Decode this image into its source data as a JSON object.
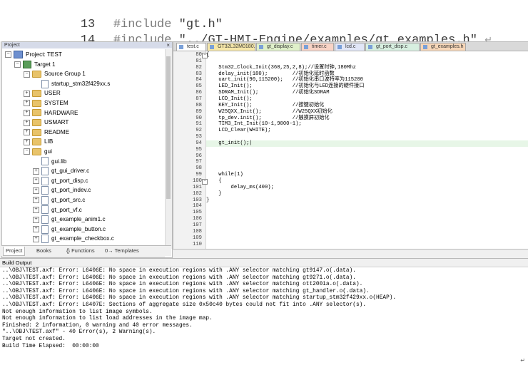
{
  "doc_snippet": {
    "lines": [
      {
        "num": "13",
        "directive": "#include",
        "path": "\"gt.h\""
      },
      {
        "num": "14",
        "directive": "#include",
        "path": "\"../GT-HMI-Engine/examples/gt_examples.h\""
      }
    ],
    "return_mark": "↵"
  },
  "project_panel": {
    "title": "Project",
    "close": "×",
    "tree": [
      {
        "label": "Project: TEST",
        "level": 0,
        "toggle": "−",
        "icon": "project"
      },
      {
        "label": "Target 1",
        "level": 1,
        "toggle": "−",
        "icon": "target"
      },
      {
        "label": "Source Group 1",
        "level": 2,
        "toggle": "−",
        "icon": "folder"
      },
      {
        "label": "startup_stm32f429xx.s",
        "level": 3,
        "toggle": "",
        "icon": "file"
      },
      {
        "label": "USER",
        "level": 2,
        "toggle": "+",
        "icon": "folder"
      },
      {
        "label": "SYSTEM",
        "level": 2,
        "toggle": "+",
        "icon": "folder"
      },
      {
        "label": "HARDWARE",
        "level": 2,
        "toggle": "+",
        "icon": "folder"
      },
      {
        "label": "USMART",
        "level": 2,
        "toggle": "+",
        "icon": "folder"
      },
      {
        "label": "README",
        "level": 2,
        "toggle": "+",
        "icon": "folder"
      },
      {
        "label": "LIB",
        "level": 2,
        "toggle": "+",
        "icon": "folder"
      },
      {
        "label": "gui",
        "level": 2,
        "toggle": "−",
        "icon": "folder"
      },
      {
        "label": "gui.lib",
        "level": 3,
        "toggle": "",
        "icon": "file"
      },
      {
        "label": "gt_gui_driver.c",
        "level": 3,
        "toggle": "+",
        "icon": "file"
      },
      {
        "label": "gt_port_disp.c",
        "level": 3,
        "toggle": "+",
        "icon": "file"
      },
      {
        "label": "gt_port_indev.c",
        "level": 3,
        "toggle": "+",
        "icon": "file"
      },
      {
        "label": "gt_port_src.c",
        "level": 3,
        "toggle": "+",
        "icon": "file"
      },
      {
        "label": "gt_port_vf.c",
        "level": 3,
        "toggle": "+",
        "icon": "file"
      },
      {
        "label": "gt_example_anim1.c",
        "level": 3,
        "toggle": "+",
        "icon": "file"
      },
      {
        "label": "gt_example_button.c",
        "level": 3,
        "toggle": "+",
        "icon": "file"
      },
      {
        "label": "gt_example_checkbox.c",
        "level": 3,
        "toggle": "+",
        "icon": "file"
      }
    ],
    "bottom_tabs": [
      "Project",
      "Books",
      "{} Functions",
      "0→ Templates"
    ]
  },
  "editor": {
    "tabs": [
      "test.c",
      "GT32L32M0180.c",
      "gt_display.c",
      "timer.c",
      "lcd.c",
      "gt_port_disp.c",
      "gt_examples.h"
    ],
    "tab_colors": [
      "#ffffff",
      "#f6e7a8",
      "#dff0c9",
      "#f8d3c5",
      "#e1e6f7",
      "#d7efe0",
      "#f7d6b7"
    ],
    "lines": [
      {
        "n": "80",
        "fold": "−",
        "code": "{"
      },
      {
        "n": "81",
        "fold": "",
        "code": ""
      },
      {
        "n": "82",
        "fold": "",
        "code": "    Stm32_Clock_Init(360,25,2,8);//设置时钟,180Mhz"
      },
      {
        "n": "83",
        "fold": "",
        "code": "    delay_init(180);        //初始化延时函数"
      },
      {
        "n": "84",
        "fold": "",
        "code": "    uart_init(90,115200);   //初始化串口波特率为115200"
      },
      {
        "n": "85",
        "fold": "",
        "code": "    LED_Init();             //初始化与LED连接的硬件接口"
      },
      {
        "n": "86",
        "fold": "",
        "code": "    SDRAM_Init();           //初始化SDRAM"
      },
      {
        "n": "87",
        "fold": "",
        "code": "    LCD_Init();"
      },
      {
        "n": "88",
        "fold": "",
        "code": "    KEY_Init();             //按键初始化"
      },
      {
        "n": "89",
        "fold": "",
        "code": "    W25QXX_Init();          //W25QXX初始化"
      },
      {
        "n": "90",
        "fold": "",
        "code": "    tp_dev.init();          //触摸屏初始化"
      },
      {
        "n": "91",
        "fold": "",
        "code": "    TIM3_Int_Init(10-1,9000-1);"
      },
      {
        "n": "92",
        "fold": "",
        "code": "    LCD_Clear(WHITE);"
      },
      {
        "n": "93",
        "fold": "",
        "code": ""
      },
      {
        "n": "94",
        "fold": "",
        "code": "    gt_init();|"
      },
      {
        "n": "95",
        "fold": "",
        "code": ""
      },
      {
        "n": "96",
        "fold": "",
        "code": ""
      },
      {
        "n": "97",
        "fold": "",
        "code": ""
      },
      {
        "n": "98",
        "fold": "",
        "code": ""
      },
      {
        "n": "99",
        "fold": "",
        "code": "    while(1)"
      },
      {
        "n": "100",
        "fold": "−",
        "code": "    {"
      },
      {
        "n": "101",
        "fold": "",
        "code": "        delay_ms(400);"
      },
      {
        "n": "102",
        "fold": "",
        "code": "    }"
      },
      {
        "n": "103",
        "fold": "",
        "code": "}"
      },
      {
        "n": "104",
        "fold": "",
        "code": ""
      },
      {
        "n": "105",
        "fold": "",
        "code": ""
      },
      {
        "n": "106",
        "fold": "",
        "code": ""
      },
      {
        "n": "107",
        "fold": "",
        "code": ""
      },
      {
        "n": "108",
        "fold": "",
        "code": ""
      },
      {
        "n": "109",
        "fold": "",
        "code": ""
      },
      {
        "n": "110",
        "fold": "",
        "code": ""
      }
    ],
    "highlight_line": "94"
  },
  "build_output": {
    "title": "Build Output",
    "lines": [
      "..\\OBJ\\TEST.axf: Error: L6406E: No space in execution regions with .ANY selector matching gt9147.o(.data).",
      "..\\OBJ\\TEST.axf: Error: L6406E: No space in execution regions with .ANY selector matching gt9271.o(.data).",
      "..\\OBJ\\TEST.axf: Error: L6406E: No space in execution regions with .ANY selector matching ott2001a.o(.data).",
      "..\\OBJ\\TEST.axf: Error: L6406E: No space in execution regions with .ANY selector matching gt_handler.o(.data).",
      "..\\OBJ\\TEST.axf: Error: L6406E: No space in execution regions with .ANY selector matching startup_stm32f429xx.o(HEAP).",
      "..\\OBJ\\TEST.axf: Error: L6407E: Sections of aggregate size 0x50c40 bytes could not fit into .ANY selector(s).",
      "Not enough information to list image symbols.",
      "Not enough information to list load addresses in the image map.",
      "Finished: 2 information, 0 warning and 40 error messages.",
      "\"..\\OBJ\\TEST.axf\" - 40 Error(s), 2 Warning(s).",
      "Target not created.",
      "Build Time Elapsed:  00:00:00"
    ],
    "corner_mark": "↵"
  }
}
